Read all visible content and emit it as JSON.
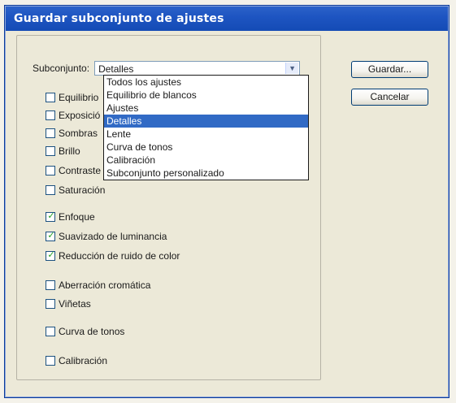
{
  "window": {
    "title": "Guardar subconjunto de ajustes"
  },
  "subset": {
    "label": "Subconjunto:",
    "value": "Detalles",
    "options": [
      "Todos los ajustes",
      "Equilibrio de blancos",
      "Ajustes",
      "Detalles",
      "Lente",
      "Curva de tonos",
      "Calibración",
      "Subconjunto personalizado"
    ],
    "selected_index": 3
  },
  "buttons": {
    "save": "Guardar...",
    "cancel": "Cancelar"
  },
  "checkboxes": [
    {
      "label": "Equilibrio",
      "checked": false
    },
    {
      "label": "Exposició",
      "checked": false
    },
    {
      "label": "Sombras",
      "checked": false
    },
    {
      "label": "Brillo",
      "checked": false
    },
    {
      "label": "Contraste",
      "checked": false
    },
    {
      "label": "Saturación",
      "checked": false
    },
    {
      "label": "Enfoque",
      "checked": true
    },
    {
      "label": "Suavizado de luminancia",
      "checked": true
    },
    {
      "label": "Reducción de ruido de color",
      "checked": true
    },
    {
      "label": "Aberración cromática",
      "checked": false
    },
    {
      "label": "Viñetas",
      "checked": false
    },
    {
      "label": "Curva de tonos",
      "checked": false
    },
    {
      "label": "Calibración",
      "checked": false
    }
  ]
}
